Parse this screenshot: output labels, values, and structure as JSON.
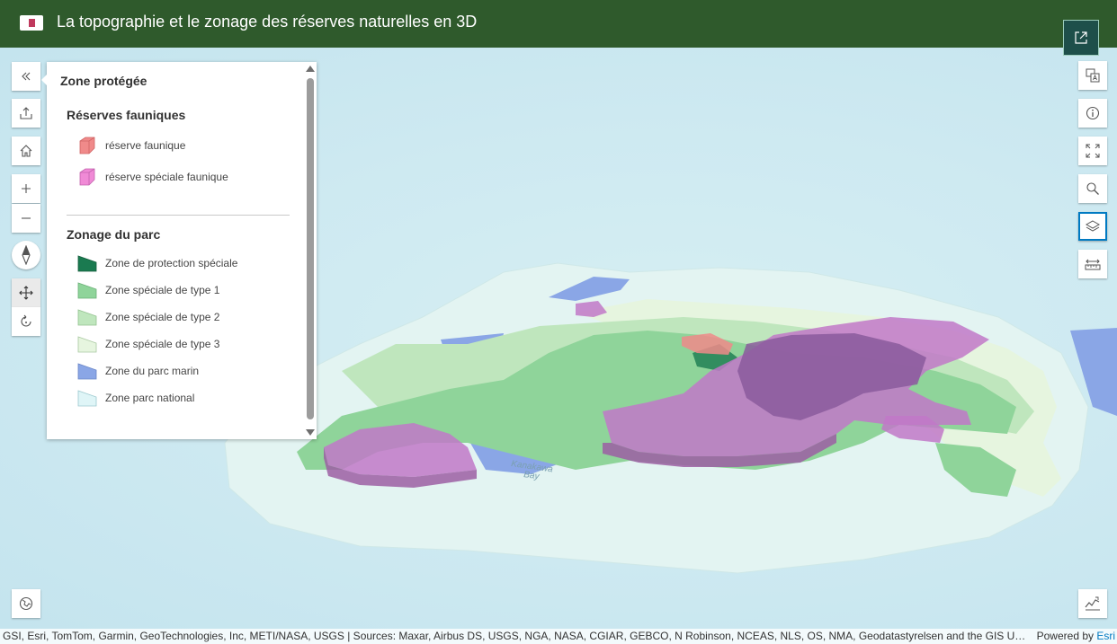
{
  "header": {
    "title": "La topographie et le zonage des réserves naturelles en 3D",
    "logo": "flag-logo-icon",
    "background": "#2f5a2c"
  },
  "toolbar_left": [
    {
      "name": "collapse-icon",
      "label": "<<"
    },
    {
      "name": "share-icon"
    },
    {
      "name": "home-icon"
    },
    {
      "name": "zoom-in-icon",
      "label": "+"
    },
    {
      "name": "zoom-out-icon",
      "label": "−"
    },
    {
      "name": "compass-icon"
    },
    {
      "name": "pan-icon",
      "active": true
    },
    {
      "name": "rotate-icon"
    },
    {
      "name": "basemap-icon"
    }
  ],
  "toolbar_right": [
    {
      "name": "open-external-icon"
    },
    {
      "name": "translate-icon"
    },
    {
      "name": "info-icon"
    },
    {
      "name": "fullscreen-icon"
    },
    {
      "name": "search-icon"
    },
    {
      "name": "layers-icon",
      "active": true
    },
    {
      "name": "measure-icon"
    },
    {
      "name": "elevation-profile-icon"
    }
  ],
  "legend": {
    "title": "Zone protégée",
    "groups": [
      {
        "title": "Réserves fauniques",
        "items": [
          {
            "label": "réserve faunique",
            "color": "#f08a8a",
            "symbol": "3d-prism"
          },
          {
            "label": "réserve spéciale faunique",
            "color": "#f08ad6",
            "symbol": "3d-prism"
          }
        ]
      },
      {
        "title": "Zonage du parc",
        "items": [
          {
            "label": "Zone de protection spéciale",
            "color": "#1a7a50"
          },
          {
            "label": "Zone spéciale de type 1",
            "color": "#8fd49a"
          },
          {
            "label": "Zone spéciale de type 2",
            "color": "#bfe6bd"
          },
          {
            "label": "Zone spéciale de type 3",
            "color": "#e6f5df"
          },
          {
            "label": "Zone du parc marin",
            "color": "#8aa6e6"
          },
          {
            "label": "Zone parc national",
            "color": "#dff5f7"
          }
        ]
      }
    ]
  },
  "map_labels": {
    "bay_name_1": "Kanakawa",
    "bay_name_2": "Bay"
  },
  "attribution": {
    "text": "GSI, Esri, TomTom, Garmin, GeoTechnologies, Inc, METI/NASA, USGS | Sources: Maxar, Airbus DS, USGS, NGA, NASA, CGIAR, GEBCO, N Robinson, NCEAS, NLS, OS, NMA, Geodatastyrelsen and the GIS User C...",
    "powered_by": "Powered by ",
    "powered_link": "Esri"
  },
  "colors": {
    "accent": "#007ac2",
    "reserve": "#f08a8a",
    "special_reserve": "#c178c8"
  }
}
